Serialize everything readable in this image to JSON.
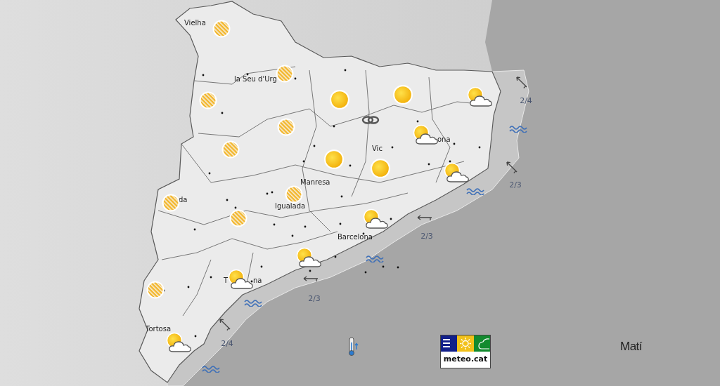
{
  "map": {
    "cities": [
      {
        "name": "Vielha"
      },
      {
        "name": "la Seu d'Urg"
      },
      {
        "name": "Vic"
      },
      {
        "name": "ona"
      },
      {
        "name": "Manresa"
      },
      {
        "name": "da"
      },
      {
        "name": "Igualada"
      },
      {
        "name": "Barcelona"
      },
      {
        "name": "T"
      },
      {
        "name": "na"
      },
      {
        "name": "Tortosa"
      }
    ],
    "forecast_icons": [
      {
        "kind": "hazy"
      },
      {
        "kind": "hazy"
      },
      {
        "kind": "hazy"
      },
      {
        "kind": "hazy"
      },
      {
        "kind": "hazy"
      },
      {
        "kind": "hazy"
      },
      {
        "kind": "hazy"
      },
      {
        "kind": "hazy"
      },
      {
        "kind": "hazy"
      },
      {
        "kind": "sun"
      },
      {
        "kind": "sun"
      },
      {
        "kind": "sun"
      },
      {
        "kind": "sun"
      },
      {
        "kind": "partly_cloudy"
      },
      {
        "kind": "partly_cloudy"
      },
      {
        "kind": "partly_cloudy"
      },
      {
        "kind": "partly_cloudy"
      },
      {
        "kind": "partly_cloudy"
      },
      {
        "kind": "partly_cloudy"
      },
      {
        "kind": "partly_cloudy"
      },
      {
        "kind": "fog"
      }
    ],
    "wave_heights": [
      "2/4",
      "2/3",
      "2/3",
      "2/3",
      "2/4"
    ],
    "period": "Matí",
    "logo": "meteo.cat"
  }
}
